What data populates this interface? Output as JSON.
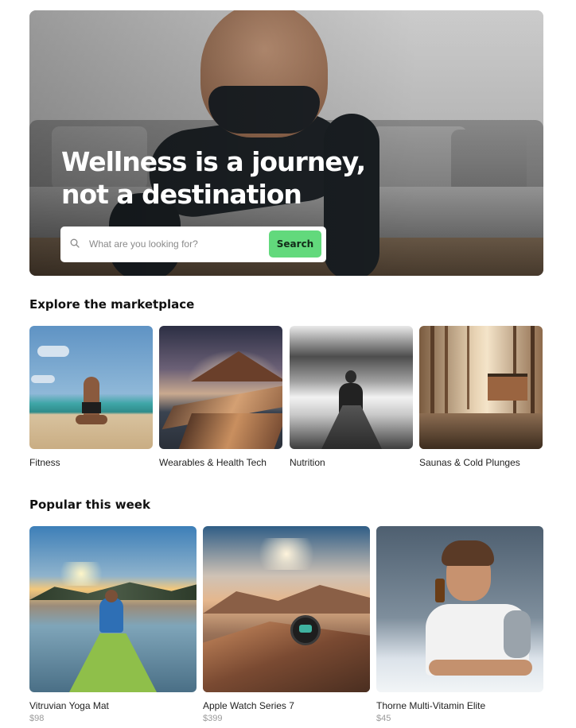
{
  "hero": {
    "title": "Wellness is a journey, not a destination",
    "search": {
      "placeholder": "What are you looking for?",
      "button_label": "Search"
    }
  },
  "marketplace": {
    "title": "Explore the marketplace",
    "categories": [
      {
        "label": "Fitness"
      },
      {
        "label": "Wearables & Health Tech"
      },
      {
        "label": "Nutrition"
      },
      {
        "label": "Saunas & Cold Plunges"
      }
    ]
  },
  "popular": {
    "title": "Popular this week",
    "products": [
      {
        "name": "Vitruvian Yoga Mat",
        "price": "$98"
      },
      {
        "name": "Apple Watch Series 7",
        "price": "$399"
      },
      {
        "name": "Thorne Multi-Vitamin Elite",
        "price": "$45"
      }
    ]
  },
  "colors": {
    "accent": "#62d97c",
    "text": "#111111",
    "muted": "#9a9a9a"
  }
}
